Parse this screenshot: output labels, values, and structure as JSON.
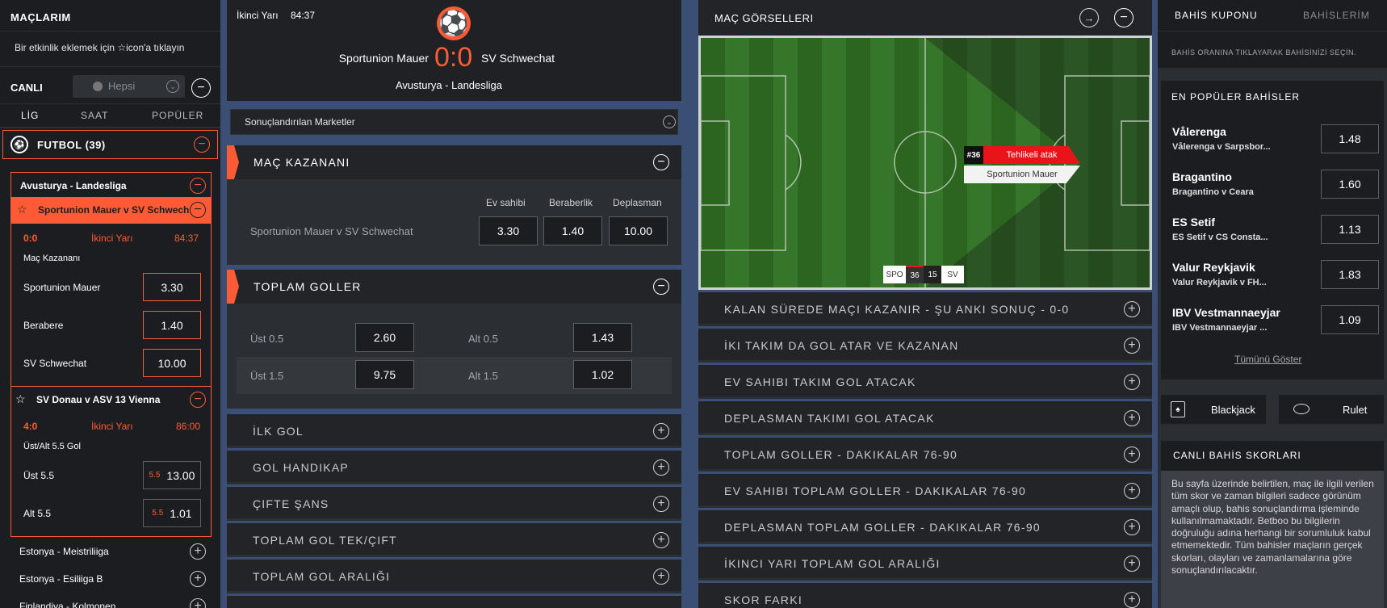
{
  "left": {
    "title": "MAÇLARIM",
    "hint": "Bir etkinlik eklemek için ☆icon'a tıklayın",
    "canli": "CANLI",
    "hepsi": "Hepsi",
    "tabs": [
      "LİG",
      "SAAT",
      "POPÜLER"
    ],
    "sport": "FUTBOL (39)",
    "league": "Avusturya - Landesliga",
    "m1": {
      "name": "Sportunion Mauer v SV Schwech",
      "score": "0:0",
      "period": "İkinci Yarı",
      "time": "84:37",
      "market": "Maç Kazananı",
      "rows": [
        {
          "label": "Sportunion Mauer",
          "odd": "3.30"
        },
        {
          "label": "Berabere",
          "odd": "1.40"
        },
        {
          "label": "SV Schwechat",
          "odd": "10.00"
        }
      ]
    },
    "m2": {
      "name": "SV Donau v ASV 13 Vienna",
      "score": "4:0",
      "period": "İkinci Yarı",
      "time": "86:00",
      "market": "Üst/Alt 5.5 Gol",
      "rows": [
        {
          "label": "Üst 5.5",
          "line": "5.5",
          "odd": "13.00"
        },
        {
          "label": "Alt 5.5",
          "line": "5.5",
          "odd": "1.01"
        }
      ]
    },
    "leagues": [
      "Estonya - Meistriliiga",
      "Estonya - Esiliiga B",
      "Finlandiya - Kolmonen"
    ]
  },
  "center": {
    "period": "İkinci Yarı",
    "clock": "84:37",
    "home": "Sportunion Mauer",
    "away": "SV Schwechat",
    "score": "0:0",
    "league": "Avusturya - Landesliga",
    "resolved": "Sonuçlandırılan Marketler",
    "winner": {
      "title": "MAÇ KAZANANI",
      "heads": [
        "Ev sahibi",
        "Beraberlik",
        "Deplasman"
      ],
      "match": "Sportunion Mauer v SV Schwechat",
      "odds": [
        "3.30",
        "1.40",
        "10.00"
      ]
    },
    "goals": {
      "title": "TOPLAM GOLLER",
      "rows": [
        {
          "o": "Üst 0.5",
          "ov": "2.60",
          "u": "Alt 0.5",
          "uv": "1.43"
        },
        {
          "o": "Üst 1.5",
          "ov": "9.75",
          "u": "Alt 1.5",
          "uv": "1.02"
        }
      ]
    },
    "markets": [
      "İLK GOL",
      "GOL HANDIKAP",
      "ÇIFTE ŞANS",
      "TOPLAM GOL TEK/ÇIFT",
      "TOPLAM GOL ARALIĞI"
    ]
  },
  "visual": {
    "title": "MAÇ GÖRSELLERI",
    "event_num": "#36",
    "event": "Tehlikeli atak",
    "team": "Sportunion Mauer",
    "stats": [
      "SPO",
      "36",
      "15",
      "SV"
    ],
    "markets": [
      "KALAN SÜREDE MAÇI KAZANIR - ŞU ANKI SONUÇ - 0-0",
      "İKI TAKIM DA GOL ATAR VE KAZANAN",
      "EV SAHIBI TAKIM GOL ATACAK",
      "DEPLASMAN TAKIMI GOL ATACAK",
      "TOPLAM GOLLER - DAKIKALAR 76-90",
      "EV SAHIBI TOPLAM GOLLER - DAKIKALAR 76-90",
      "DEPLASMAN TOPLAM GOLLER - DAKIKALAR 76-90",
      "İKINCI YARI TOPLAM GOL ARALIĞI",
      "SKOR FARKI"
    ]
  },
  "right": {
    "tab1": "BAHİS KUPONU",
    "tab2": "BAHİSLERİM",
    "hint": "BAHİS ORANINA TIKLAYARAK BAHİSİNİZİ SEÇİN.",
    "popular": "EN POPÜLER BAHİSLER",
    "bets": [
      {
        "team": "Vålerenga",
        "match": "Vålerenga v Sarpsbor...",
        "odd": "1.48"
      },
      {
        "team": "Bragantino",
        "match": "Bragantino v Ceara",
        "odd": "1.60"
      },
      {
        "team": "ES Setif",
        "match": "ES Setif v CS Consta...",
        "odd": "1.13"
      },
      {
        "team": "Valur Reykjavik",
        "match": "Valur Reykjavik v FH...",
        "odd": "1.83"
      },
      {
        "team": "IBV Vestmannaeyjar",
        "match": "IBV Vestmannaeyjar ...",
        "odd": "1.09"
      }
    ],
    "show_all": "Tümünü Göster",
    "blackjack": "Blackjack",
    "rulet": "Rulet",
    "scores_title": "CANLI BAHİS SKORLARI",
    "scores_text": "Bu sayfa üzerinde belirtilen, maç ile ilgili verilen tüm skor ve zaman bilgileri sadece görünüm amaçlı olup, bahis sonuçlandırma işleminde kullanılmamaktadır. Betboo bu bilgilerin doğruluğu adına herhangi bir sorumluluk kabul etmemektedir. Tüm bahisler maçların gerçek skorları, olayları ve zamanlamalarına göre sonuçlandırılacaktır."
  },
  "colors": {
    "accent": "#ff5a36",
    "panel": "#1b1d20",
    "bg": "#3b4f74"
  }
}
